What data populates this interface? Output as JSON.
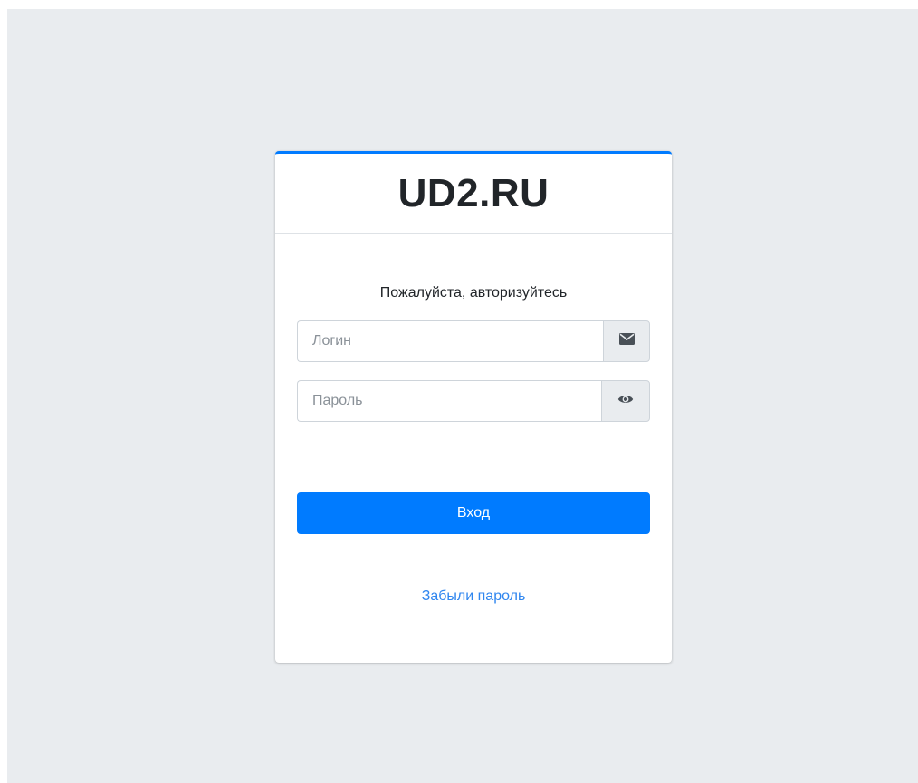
{
  "brand": {
    "title": "UD2.RU"
  },
  "login": {
    "message": "Пожалуйста, авторизуйтесь",
    "login_placeholder": "Логин",
    "password_placeholder": "Пароль",
    "submit_label": "Вход",
    "forgot_label": "Забыли пароль"
  },
  "icons": {
    "login_addon": "envelope-icon",
    "password_addon": "eye-icon"
  },
  "colors": {
    "accent": "#007bff",
    "link": "#2f86ef",
    "background": "#e9ecef"
  }
}
